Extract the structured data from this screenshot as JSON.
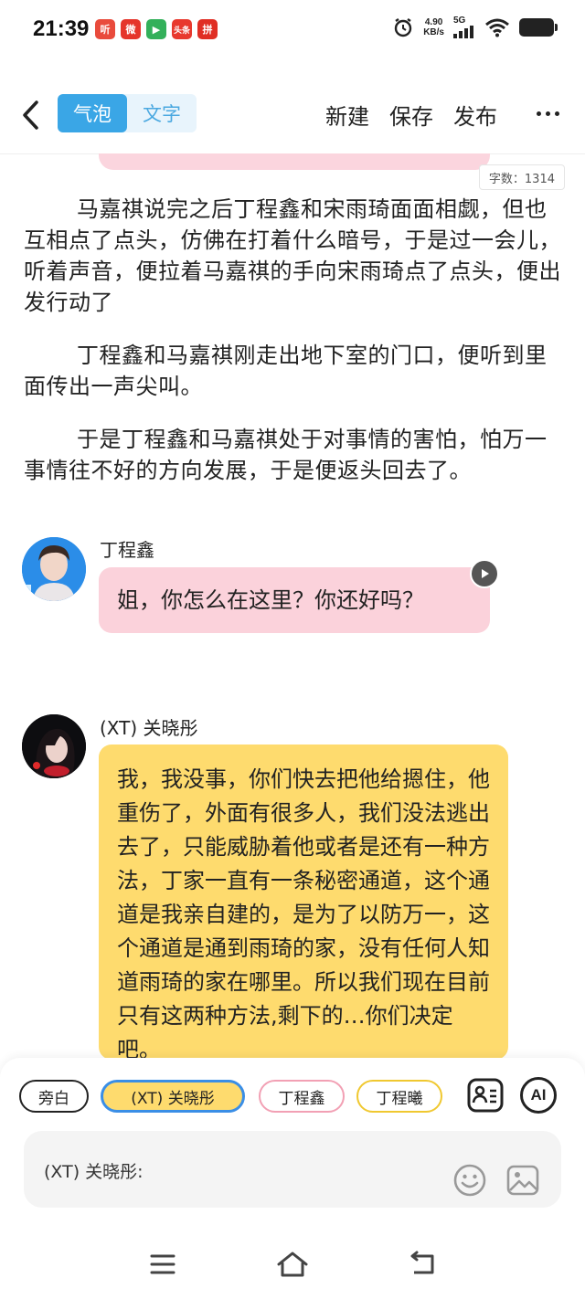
{
  "status_bar": {
    "time": "21:39",
    "apps": [
      {
        "label": "听",
        "color": "#e94b3c"
      },
      {
        "label": "微",
        "color": "#e5352b"
      },
      {
        "label": "▶",
        "color": "#33b05a"
      },
      {
        "label": "头条",
        "color": "#e8392e"
      },
      {
        "label": "拼",
        "color": "#e02e24"
      }
    ],
    "net_speed_value": "4.90",
    "net_speed_unit": "KB/s",
    "network": "5G"
  },
  "toolbar": {
    "back_icon": "chevron-left-icon",
    "mode_tabs": [
      {
        "label": "气泡",
        "active": true
      },
      {
        "label": "文字",
        "active": false
      }
    ],
    "actions": [
      "新建",
      "保存",
      "发布"
    ],
    "more_icon": "more-horizontal-icon"
  },
  "word_count": "字数：1314",
  "narrations": [
    "马嘉祺说完之后丁程鑫和宋雨琦面面相觑，但也互相点了点头，仿佛在打着什么暗号，于是过一会儿，听着声音，便拉着马嘉祺的手向宋雨琦点了点头，便出发行动了",
    "丁程鑫和马嘉祺刚走出地下室的门口，便听到里面传出一声尖叫。",
    "于是丁程鑫和马嘉祺处于对事情的害怕，怕万一事情往不好的方向发展，于是便返头回去了。"
  ],
  "messages": [
    {
      "speaker": "丁程鑫",
      "text": "姐，你怎么在这里？你还好吗？",
      "bubble_color": "#fbd2db"
    },
    {
      "speaker": "(XT) 关晓彤",
      "text": "我，我没事，你们快去把他给摁住，他重伤了，外面有很多人，我们没法逃出去了，只能威胁着他或者是还有一种方法，丁家一直有一条秘密通道，这个通道是我亲自建的，是为了以防万一，这个通道是通到雨琦的家，没有任何人知道雨琦的家在哪里。所以我们现在目前只有这两种方法,剩下的…你们决定吧。",
      "bubble_color": "#fedb6e"
    }
  ],
  "role_chips": [
    {
      "label": "旁白",
      "border": "#222222"
    },
    {
      "label": "(XT) 关晓彤",
      "border": "#3a8ee6",
      "bg": "#fedb6e"
    },
    {
      "label": "丁程鑫",
      "border": "#f2a0b4"
    },
    {
      "label": "丁程曦",
      "border": "#f0c830"
    }
  ],
  "role_icons": [
    "contact-card-icon",
    "ai-icon"
  ],
  "ai_label": "AI",
  "input": {
    "prefix": "(XT) 关晓彤:",
    "icons": [
      "emoji-icon",
      "image-icon"
    ]
  },
  "nav_bar": [
    "menu-icon",
    "home-icon",
    "back-icon"
  ]
}
